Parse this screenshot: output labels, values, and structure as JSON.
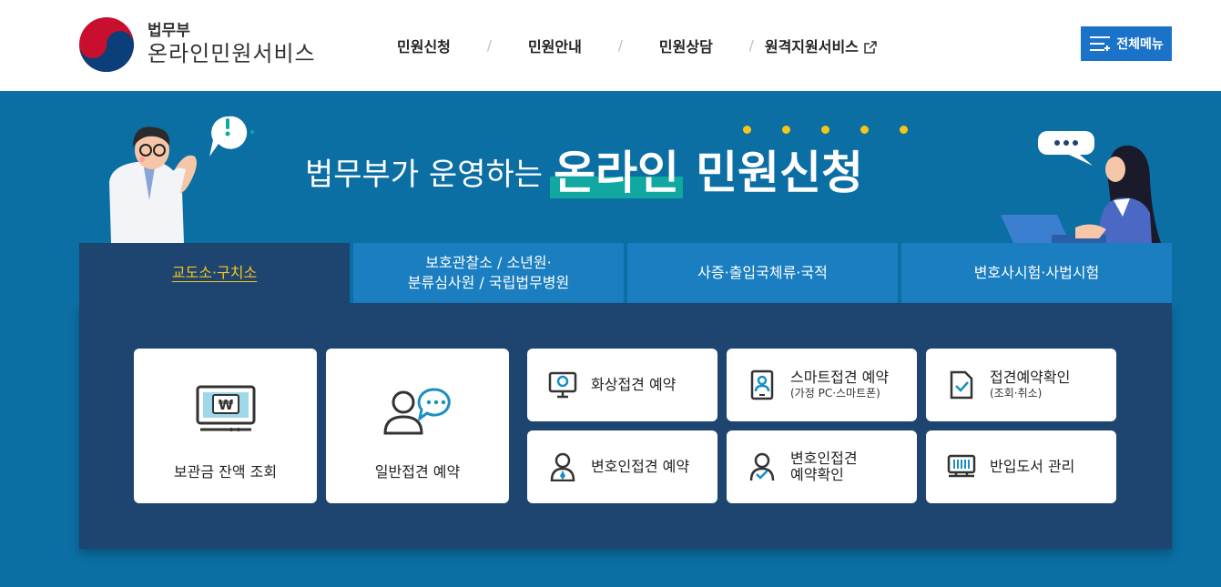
{
  "header": {
    "logo_top": "법무부",
    "logo_bottom": "온라인민원서비스",
    "nav": [
      {
        "label": "민원신청"
      },
      {
        "label": "민원안내"
      },
      {
        "label": "민원상담"
      },
      {
        "label": "원격지원서비스"
      }
    ],
    "nav_separator": "/",
    "all_menu_label": "전체메뉴"
  },
  "banner": {
    "sub": "법무부가 운영하는",
    "highlight": "온라인",
    "main": "민원신청"
  },
  "tabs": [
    {
      "label": "교도소·구치소",
      "active": true
    },
    {
      "label": "보호관찰소 / 소년원·\n분류심사원 / 국립법무병원",
      "active": false
    },
    {
      "label": "사증·출입국체류·국적",
      "active": false
    },
    {
      "label": "변호사시험·사법시험",
      "active": false
    }
  ],
  "cards": {
    "balance": {
      "label": "보관금 잔액 조회",
      "icon": "monitor-won-icon"
    },
    "general": {
      "label": "일반접견 예약",
      "icon": "person-chat-icon"
    },
    "video": {
      "label": "화상접견 예약",
      "icon": "video-call-icon"
    },
    "smart": {
      "label": "스마트접견 예약",
      "sub": "(가정 PC·스마트폰)",
      "icon": "tablet-person-icon"
    },
    "confirm": {
      "label": "접견예약확인",
      "sub": "(조회·취소)",
      "icon": "document-check-icon"
    },
    "lawyer": {
      "label": "변호인접견 예약",
      "icon": "lawyer-icon"
    },
    "lawyer_confirm": {
      "label": "변호인접견\n예약확인",
      "icon": "person-check-icon"
    },
    "books": {
      "label": "반입도서 관리",
      "icon": "bookshelf-icon"
    }
  },
  "colors": {
    "accent": "#1a73c9",
    "banner_bg": "#0b6fa4",
    "panel_bg": "#1e4470",
    "active_tab_text": "#f5c518",
    "highlight": "#10a8a0"
  }
}
